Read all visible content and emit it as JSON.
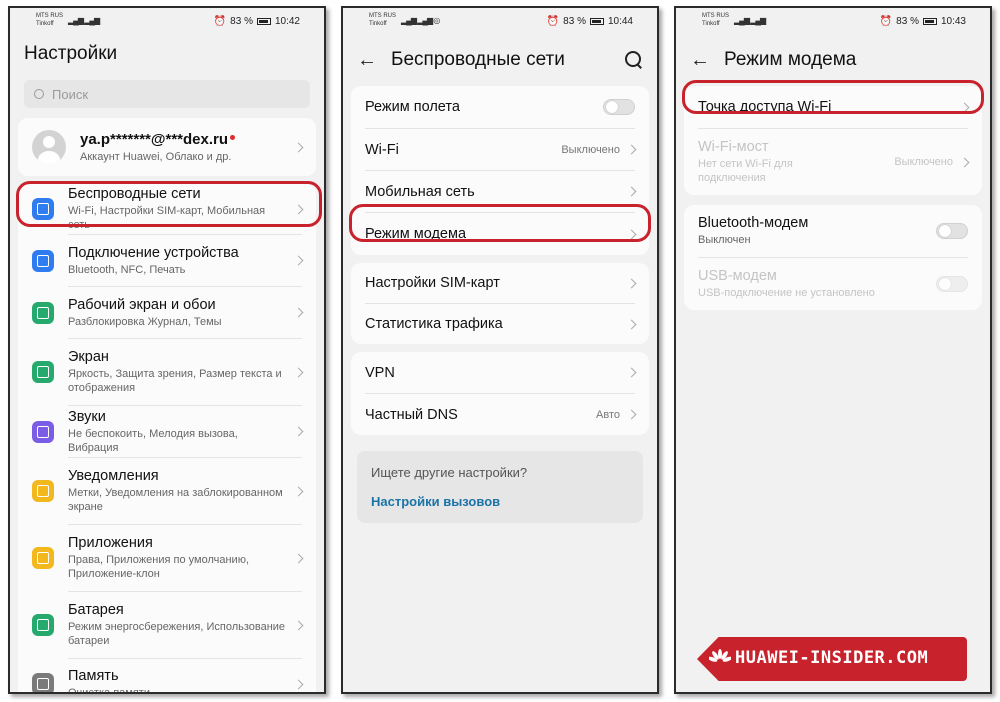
{
  "panel1": {
    "status": {
      "carrier1": "MTS RUS",
      "carrier2": "Tinkoff",
      "battery": "83 %",
      "time": "10:42"
    },
    "title": "Настройки",
    "search_placeholder": "Поиск",
    "account": {
      "name": "ya.p*******@***dex.ru",
      "sub": "Аккаунт Huawei, Облако и др."
    },
    "items": [
      {
        "label": "Беспроводные сети",
        "sub": "Wi-Fi, Настройки SIM-карт, Мобильная сеть",
        "icon": "wifi-icon",
        "color": "#2f7bf0"
      },
      {
        "label": "Подключение устройства",
        "sub": "Bluetooth, NFC, Печать",
        "icon": "devices-icon",
        "color": "#2f7bf0"
      },
      {
        "label": "Рабочий экран и обои",
        "sub": "Разблокировка Журнал, Темы",
        "icon": "wallpaper-icon",
        "color": "#26a96c"
      },
      {
        "label": "Экран",
        "sub": "Яркость, Защита зрения, Размер текста и отображения",
        "icon": "display-icon",
        "color": "#26a96c"
      },
      {
        "label": "Звуки",
        "sub": "Не беспокоить, Мелодия вызова, Вибрация",
        "icon": "sound-icon",
        "color": "#7b5ce6"
      },
      {
        "label": "Уведомления",
        "sub": "Метки, Уведомления на заблокированном экране",
        "icon": "bell-icon",
        "color": "#f3b81e"
      },
      {
        "label": "Приложения",
        "sub": "Права, Приложения по умолчанию, Приложение-клон",
        "icon": "apps-icon",
        "color": "#f3b81e"
      },
      {
        "label": "Батарея",
        "sub": "Режим энергосбережения, Использование батареи",
        "icon": "battery-icon",
        "color": "#26a96c"
      },
      {
        "label": "Память",
        "sub": "Очистка памяти",
        "icon": "storage-icon",
        "color": "#7a7a7a"
      }
    ]
  },
  "panel2": {
    "status": {
      "carrier1": "MTS RUS",
      "carrier2": "Tinkoff",
      "battery": "83 %",
      "time": "10:44"
    },
    "title": "Беспроводные сети",
    "group1": [
      {
        "label": "Режим полета",
        "type": "toggle"
      },
      {
        "label": "Wi-Fi",
        "value": "Выключено"
      },
      {
        "label": "Мобильная сеть"
      },
      {
        "label": "Режим модема"
      }
    ],
    "group2": [
      {
        "label": "Настройки SIM-карт"
      },
      {
        "label": "Статистика трафика"
      }
    ],
    "group3": [
      {
        "label": "VPN"
      },
      {
        "label": "Частный DNS",
        "value": "Авто"
      }
    ],
    "more": {
      "question": "Ищете другие настройки?",
      "link": "Настройки вызовов"
    }
  },
  "panel3": {
    "status": {
      "carrier1": "MTS RUS",
      "carrier2": "Tinkoff",
      "battery": "83 %",
      "time": "10:43"
    },
    "title": "Режим модема",
    "hotspot": "Точка доступа Wi-Fi",
    "wifi_bridge": {
      "label": "Wi-Fi-мост",
      "sub": "Нет сети Wi-Fi для подключения",
      "value": "Выключено"
    },
    "bt": {
      "label": "Bluetooth-модем",
      "sub": "Выключен"
    },
    "usb": {
      "label": "USB-модем",
      "sub": "USB-подключение не установлено"
    }
  },
  "logo": {
    "text": "HUAWEI-INSIDER.COM"
  },
  "colors": {
    "highlight": "#c8232c",
    "link": "#1b74a8"
  }
}
